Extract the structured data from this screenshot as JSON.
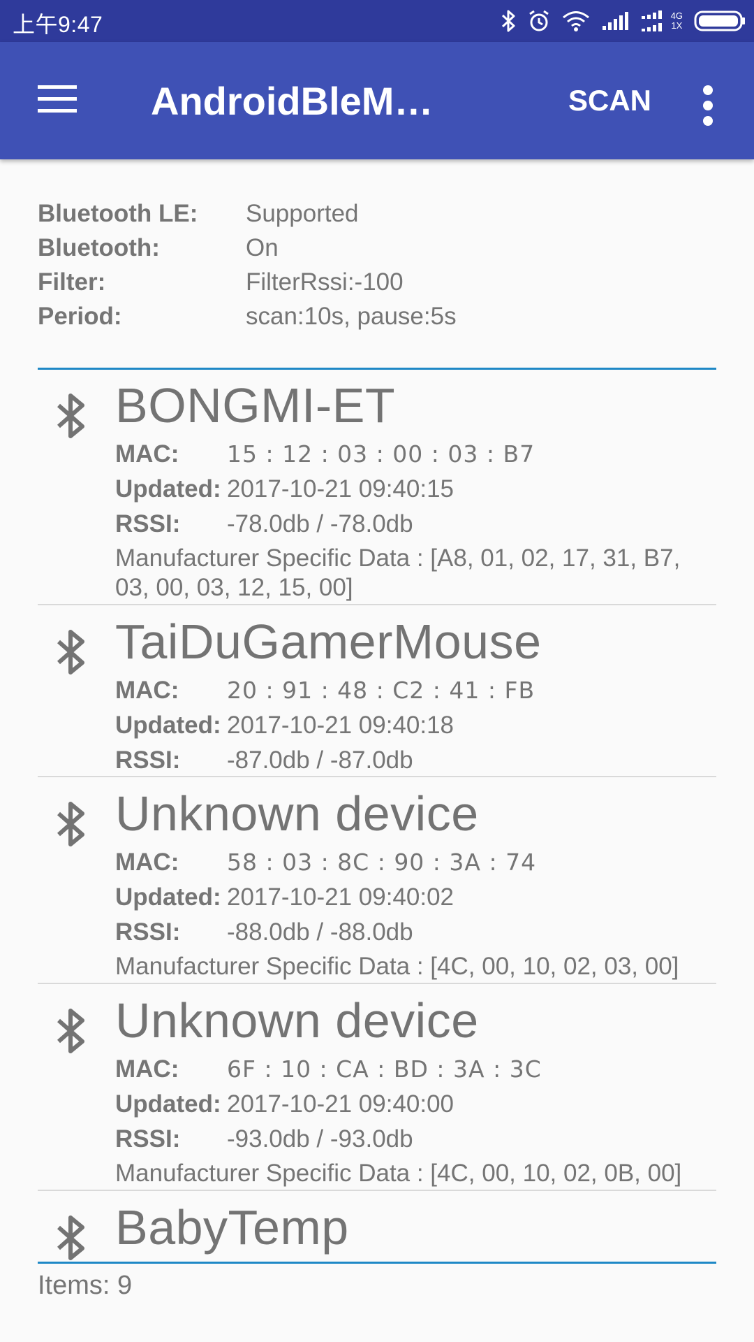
{
  "status_bar": {
    "time": "上午9:47",
    "network_top": "4G",
    "network_bottom": "1X",
    "icons": [
      "bluetooth-icon",
      "alarm-icon",
      "wifi-icon",
      "signal-icon",
      "signal-icon",
      "battery-icon"
    ]
  },
  "app_bar": {
    "title": "AndroidBleM…",
    "scan_label": "SCAN",
    "menu_icon": "hamburger-menu-icon",
    "overflow_icon": "more-vert-icon",
    "color": "#3f51b5"
  },
  "info": {
    "bluetooth_le_label": "Bluetooth LE:",
    "bluetooth_le_value": "Supported",
    "bluetooth_label": "Bluetooth:",
    "bluetooth_value": "On",
    "filter_label": "Filter:",
    "filter_value": "FilterRssi:-100",
    "period_label": "Period:",
    "period_value": "scan:10s, pause:5s"
  },
  "labels": {
    "mac": "MAC:",
    "updated": "Updated:",
    "rssi": "RSSI:"
  },
  "devices": [
    {
      "name": "BONGMI-ET",
      "mac": "15 : 12 : 03 : 00 : 03 : B7",
      "updated": "2017-10-21 09:40:15",
      "rssi": "-78.0db / -78.0db",
      "msd": "Manufacturer Specific Data : [A8, 01, 02, 17, 31, B7, 03, 00, 03, 12, 15, 00]"
    },
    {
      "name": "TaiDuGamerMouse",
      "mac": "20 : 91 : 48 : C2 : 41 : FB",
      "updated": "2017-10-21 09:40:18",
      "rssi": "-87.0db / -87.0db"
    },
    {
      "name": "Unknown device",
      "mac": "58 : 03 : 8C : 90 : 3A : 74",
      "updated": "2017-10-21 09:40:02",
      "rssi": "-88.0db / -88.0db",
      "msd": "Manufacturer Specific Data : [4C, 00, 10, 02, 03, 00]"
    },
    {
      "name": "Unknown device",
      "mac": "6F : 10 : CA : BD : 3A : 3C",
      "updated": "2017-10-21 09:40:00",
      "rssi": "-93.0db / -93.0db",
      "msd": "Manufacturer Specific Data : [4C, 00, 10, 02, 0B, 00]"
    },
    {
      "name": "BabyTemp"
    }
  ],
  "items_count": "Items: 9",
  "colors": {
    "status_bar": "#2f3a9b",
    "accent_divider": "#1e88c6",
    "text_gray": "#757575"
  }
}
